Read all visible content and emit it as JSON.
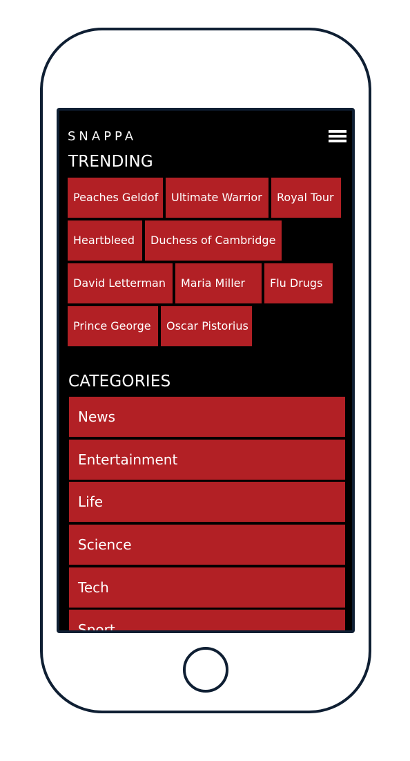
{
  "app": {
    "logo": "SNAPPA"
  },
  "trending": {
    "title": "TRENDING",
    "tags": [
      "Peaches Geldof",
      "Ultimate Warrior",
      "Royal Tour",
      "Heartbleed",
      "Duchess of Cambridge",
      "David Letterman",
      "Maria Miller",
      "Flu Drugs",
      "Prince George",
      "Oscar Pistorius"
    ]
  },
  "categories": {
    "title": "CATEGORIES",
    "items": [
      "News",
      "Entertainment",
      "Life",
      "Science",
      "Tech",
      "Sport"
    ]
  },
  "colors": {
    "accent_red": "#b22025",
    "screen_bg": "#000000",
    "device_outline": "#0f1f33"
  },
  "icons": {
    "menu": "hamburger-menu-icon"
  }
}
